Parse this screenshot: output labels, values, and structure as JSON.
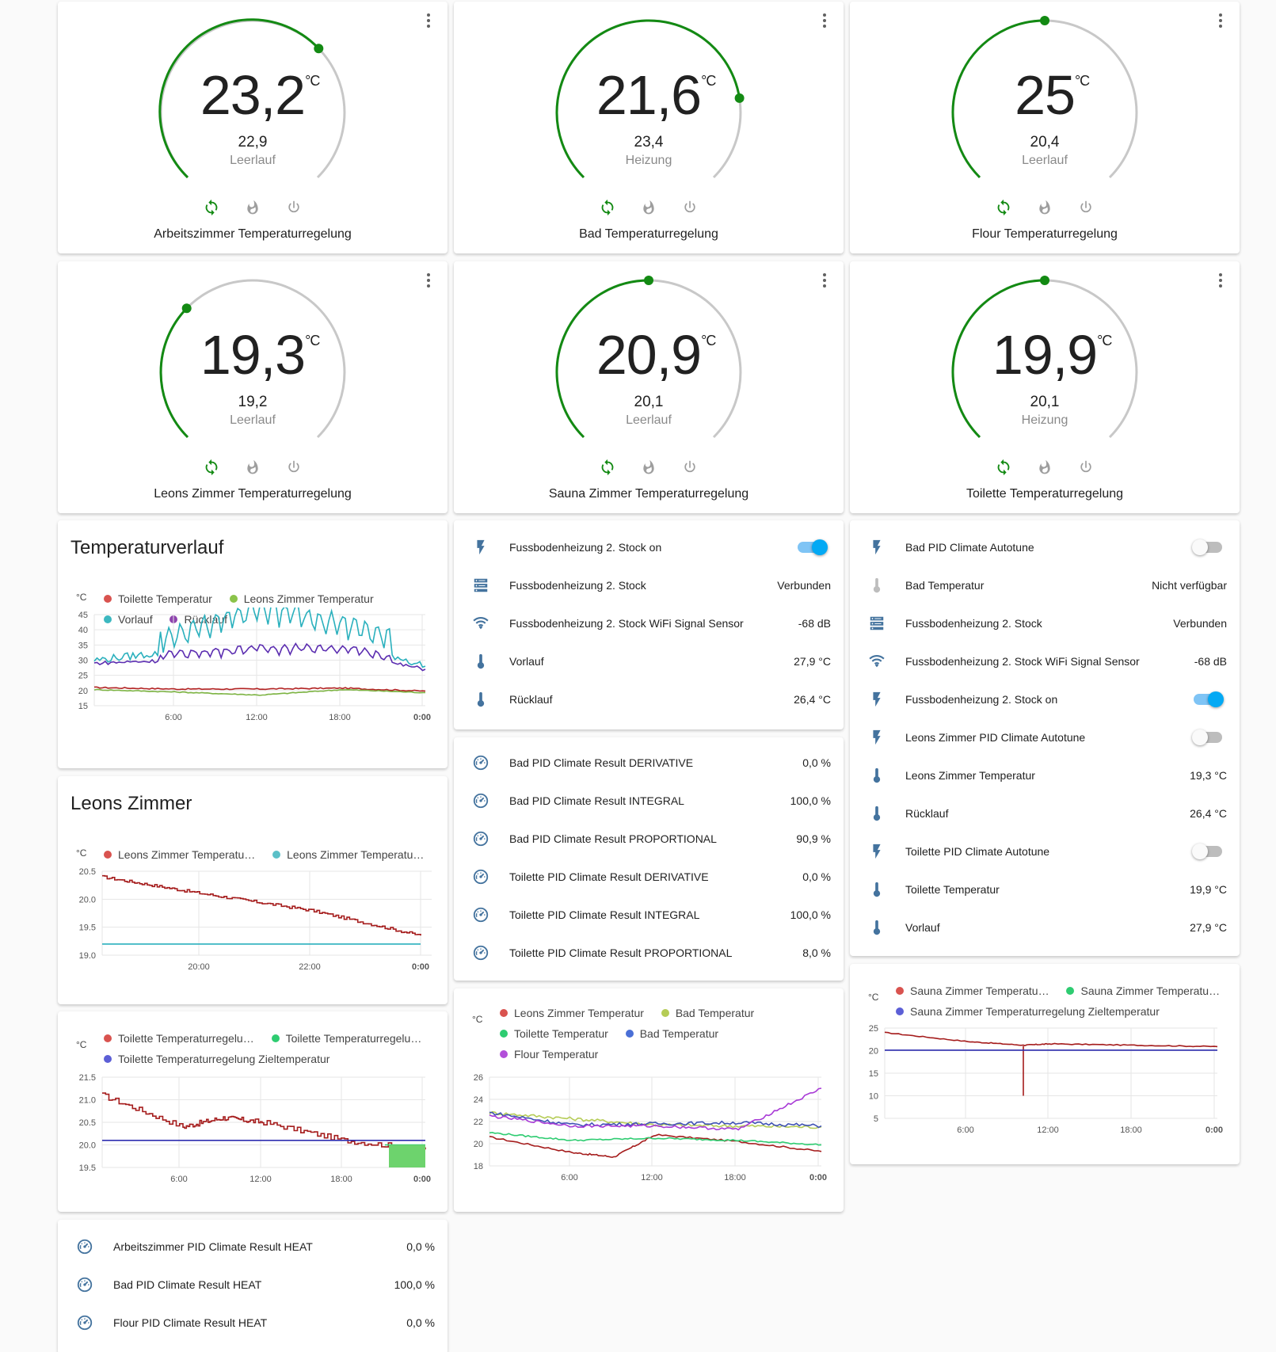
{
  "colors": {
    "green": "#138a13",
    "gray_arc": "#c8c8c8",
    "icon_blue": "#44739e",
    "red": "#c0392b",
    "teal": "#3cb8c0",
    "lime": "#8bc34a",
    "purple": "#6a2fb5",
    "blue": "#3f51b5",
    "mgreen": "#2ecc71"
  },
  "thermostats": [
    {
      "current": "23,2",
      "unit": "°C",
      "target": "22,9",
      "action": "Leerlauf",
      "name": "Arbeitszimmer Temperaturregelung",
      "target_fraction": 0.67
    },
    {
      "current": "21,6",
      "unit": "°C",
      "target": "23,4",
      "action": "Heizung",
      "name": "Bad Temperaturregelung",
      "target_fraction": 0.8
    },
    {
      "current": "25",
      "unit": "°C",
      "target": "20,4",
      "action": "Leerlauf",
      "name": "Flour Temperaturregelung",
      "target_fraction": 0.5
    },
    {
      "current": "19,3",
      "unit": "°C",
      "target": "19,2",
      "action": "Leerlauf",
      "name": "Leons Zimmer Temperaturregelung",
      "target_fraction": 0.33
    },
    {
      "current": "20,9",
      "unit": "°C",
      "target": "20,1",
      "action": "Leerlauf",
      "name": "Sauna Zimmer Temperaturregelung",
      "target_fraction": 0.5
    },
    {
      "current": "19,9",
      "unit": "°C",
      "target": "20,1",
      "action": "Heizung",
      "name": "Toilette Temperaturregelung",
      "target_fraction": 0.5
    }
  ],
  "mode_icons": [
    "auto-mode-icon",
    "heat-mode-icon",
    "off-mode-icon"
  ],
  "history": {
    "title": "Temperaturverlauf",
    "unit": "°C",
    "legend": [
      "Toilette Temperatur",
      "Leons Zimmer Temperatur",
      "Vorlauf",
      "Rücklauf"
    ]
  },
  "leons": {
    "title": "Leons Zimmer",
    "unit": "°C",
    "legend": [
      "Leons Zimmer Temperatu…",
      "Leons Zimmer Temperatu…"
    ]
  },
  "toilette_chart": {
    "unit": "°C",
    "legend": [
      "Toilette Temperaturregelu…",
      "Toilette Temperaturregelu…",
      "Toilette Temperaturregelung Zieltemperatur"
    ]
  },
  "multi_chart": {
    "unit": "°C",
    "legend": [
      "Leons Zimmer Temperatur",
      "Bad Temperatur",
      "Toilette Temperatur",
      "Bad Temperatur",
      "Flour Temperatur"
    ]
  },
  "sauna_chart": {
    "unit": "°C",
    "legend": [
      "Sauna Zimmer Temperatu…",
      "Sauna Zimmer Temperatu…",
      "Sauna Zimmer Temperaturregelung Zieltemperatur"
    ]
  },
  "chart_data": [
    {
      "type": "line",
      "title": "Temperaturverlauf",
      "ylabel": "°C",
      "ylim": [
        15,
        45
      ],
      "y_ticks": [
        "45",
        "40",
        "35",
        "30",
        "25",
        "20",
        "15"
      ],
      "x_ticks": [
        "6:00",
        "12:00",
        "18:00",
        "0:00"
      ],
      "series": [
        {
          "name": "Toilette Temperatur",
          "x": [
            "0:00",
            "6:00",
            "12:00",
            "18:00",
            "0:00"
          ],
          "values": [
            21.0,
            20.5,
            20.5,
            20.8,
            19.8
          ]
        },
        {
          "name": "Leons Zimmer Temperatur",
          "x": [
            "0:00",
            "6:00",
            "12:00",
            "18:00",
            "0:00"
          ],
          "values": [
            20.3,
            19.5,
            18.5,
            20.3,
            19.3
          ]
        },
        {
          "name": "Vorlauf",
          "x": [
            "0:00",
            "6:00",
            "12:00",
            "18:00",
            "0:00"
          ],
          "values": [
            30,
            33,
            42,
            37,
            28
          ]
        },
        {
          "name": "Rücklauf",
          "x": [
            "0:00",
            "6:00",
            "12:00",
            "18:00",
            "0:00"
          ],
          "values": [
            29,
            30,
            32,
            32,
            27
          ]
        }
      ]
    },
    {
      "type": "line",
      "title": "Leons Zimmer",
      "ylabel": "°C",
      "ylim": [
        19.0,
        20.5
      ],
      "y_ticks": [
        "20.5",
        "20.0",
        "19.5",
        "19.0"
      ],
      "x_ticks": [
        "20:00",
        "22:00",
        "0:00"
      ],
      "series": [
        {
          "name": "Leons Zimmer Temperatu…",
          "x": [
            "18:10",
            "20:00",
            "22:00",
            "0:00"
          ],
          "values": [
            20.4,
            20.1,
            19.8,
            19.35
          ]
        },
        {
          "name": "Leons Zimmer Temperatu…",
          "x": [
            "18:10",
            "20:00",
            "22:00",
            "0:00"
          ],
          "values": [
            19.2,
            19.2,
            19.2,
            19.2
          ]
        }
      ]
    },
    {
      "type": "line",
      "ylabel": "°C",
      "ylim": [
        19.5,
        21.5
      ],
      "y_ticks": [
        "21.5",
        "21.0",
        "20.5",
        "20.0",
        "19.5"
      ],
      "x_ticks": [
        "6:00",
        "12:00",
        "18:00",
        "0:00"
      ],
      "series": [
        {
          "name": "Toilette Temperaturregelu…",
          "x": [
            "0:00",
            "6:00",
            "9:00",
            "12:00",
            "18:00",
            "0:00"
          ],
          "values": [
            21.1,
            20.4,
            20.6,
            20.5,
            20.1,
            19.9
          ]
        },
        {
          "name": "Toilette Temperaturregelu…",
          "x": [
            "21:00",
            "0:00"
          ],
          "values": [
            20.0,
            20.0
          ]
        },
        {
          "name": "Toilette Temperaturregelung Zieltemperatur",
          "x": [
            "0:00",
            "0:00"
          ],
          "values": [
            20.1,
            20.1
          ]
        }
      ]
    },
    {
      "type": "line",
      "ylabel": "°C",
      "ylim": [
        18,
        26
      ],
      "y_ticks": [
        "26",
        "24",
        "22",
        "20",
        "18"
      ],
      "x_ticks": [
        "6:00",
        "12:00",
        "18:00",
        "0:00"
      ],
      "series": [
        {
          "name": "Leons Zimmer Temperatur",
          "x": [
            "0:00",
            "6:00",
            "9:00",
            "12:00",
            "18:00",
            "0:00"
          ],
          "values": [
            20.6,
            19.2,
            18.8,
            20.8,
            20.2,
            19.3
          ]
        },
        {
          "name": "Bad Temperatur",
          "x": [
            "0:00",
            "12:00",
            "0:00"
          ],
          "values": [
            22.8,
            21.7,
            21.5
          ]
        },
        {
          "name": "Toilette Temperatur",
          "x": [
            "0:00",
            "6:00",
            "12:00",
            "18:00",
            "0:00"
          ],
          "values": [
            21.0,
            20.3,
            20.5,
            20.3,
            19.9
          ]
        },
        {
          "name": "Bad Temperatur",
          "x": [
            "0:00",
            "6:00",
            "12:00",
            "18:00",
            "0:00"
          ],
          "values": [
            22.8,
            21.7,
            21.8,
            21.9,
            21.6
          ]
        },
        {
          "name": "Flour Temperatur",
          "x": [
            "0:00",
            "6:00",
            "12:00",
            "18:00",
            "0:00"
          ],
          "values": [
            22.5,
            21.6,
            21.6,
            21.3,
            25
          ]
        }
      ]
    },
    {
      "type": "line",
      "ylabel": "°C",
      "ylim": [
        5,
        25
      ],
      "y_ticks": [
        "25",
        "20",
        "15",
        "10",
        "5"
      ],
      "x_ticks": [
        "6:00",
        "12:00",
        "18:00",
        "0:00"
      ],
      "series": [
        {
          "name": "Sauna Zimmer Temperatu…",
          "x": [
            "0:00",
            "6:00",
            "10:00",
            "12:00",
            "18:00",
            "0:00"
          ],
          "values": [
            24,
            22,
            21.2,
            21.5,
            21.2,
            20.9
          ]
        },
        {
          "name": "Sauna Zimmer Temperatu…",
          "x": [
            "10:00",
            "10:00"
          ],
          "values": [
            21,
            10
          ]
        },
        {
          "name": "Sauna Zimmer Temperaturregelung Zieltemperatur",
          "x": [
            "0:00",
            "0:00"
          ],
          "values": [
            20.1,
            20.1
          ]
        }
      ]
    }
  ],
  "entities_mid1": [
    {
      "icon": "flash-icon",
      "name": "Fussbodenheizung 2. Stock on",
      "toggle": "on"
    },
    {
      "icon": "server-icon",
      "name": "Fussbodenheizung 2. Stock",
      "value": "Verbunden"
    },
    {
      "icon": "wifi-icon",
      "name": "Fussbodenheizung 2. Stock WiFi Signal Sensor",
      "value": "-68 dB"
    },
    {
      "icon": "thermometer-icon",
      "name": "Vorlauf",
      "value": "27,9 °C"
    },
    {
      "icon": "thermometer-icon",
      "name": "Rücklauf",
      "value": "26,4 °C"
    }
  ],
  "entities_mid2": [
    {
      "icon": "gauge-icon",
      "name": "Bad PID Climate Result DERIVATIVE",
      "value": "0,0 %"
    },
    {
      "icon": "gauge-icon",
      "name": "Bad PID Climate Result INTEGRAL",
      "value": "100,0 %"
    },
    {
      "icon": "gauge-icon",
      "name": "Bad PID Climate Result PROPORTIONAL",
      "value": "90,9 %"
    },
    {
      "icon": "gauge-icon",
      "name": "Toilette PID Climate Result DERIVATIVE",
      "value": "0,0 %"
    },
    {
      "icon": "gauge-icon",
      "name": "Toilette PID Climate Result INTEGRAL",
      "value": "100,0 %"
    },
    {
      "icon": "gauge-icon",
      "name": "Toilette PID Climate Result PROPORTIONAL",
      "value": "8,0 %"
    }
  ],
  "entities_right": [
    {
      "icon": "flash-icon",
      "name": "Bad PID Climate Autotune",
      "toggle": "off"
    },
    {
      "icon": "thermometer-icon",
      "name": "Bad Temperatur",
      "value": "Nicht verfügbar",
      "dim": true
    },
    {
      "icon": "server-icon",
      "name": "Fussbodenheizung 2. Stock",
      "value": "Verbunden"
    },
    {
      "icon": "wifi-icon",
      "name": "Fussbodenheizung 2. Stock WiFi Signal Sensor",
      "value": "-68 dB"
    },
    {
      "icon": "flash-icon",
      "name": "Fussbodenheizung 2. Stock on",
      "toggle": "on"
    },
    {
      "icon": "flash-icon",
      "name": "Leons Zimmer PID Climate Autotune",
      "toggle": "off"
    },
    {
      "icon": "thermometer-icon",
      "name": "Leons Zimmer Temperatur",
      "value": "19,3 °C"
    },
    {
      "icon": "thermometer-icon",
      "name": "Rücklauf",
      "value": "26,4 °C"
    },
    {
      "icon": "flash-icon",
      "name": "Toilette PID Climate Autotune",
      "toggle": "off"
    },
    {
      "icon": "thermometer-icon",
      "name": "Toilette Temperatur",
      "value": "19,9 °C"
    },
    {
      "icon": "thermometer-icon",
      "name": "Vorlauf",
      "value": "27,9 °C"
    }
  ],
  "entities_bottom": [
    {
      "icon": "gauge-icon",
      "name": "Arbeitszimmer PID Climate Result HEAT",
      "value": "0,0 %"
    },
    {
      "icon": "gauge-icon",
      "name": "Bad PID Climate Result HEAT",
      "value": "100,0 %"
    },
    {
      "icon": "gauge-icon",
      "name": "Flour PID Climate Result HEAT",
      "value": "0,0 %"
    }
  ]
}
